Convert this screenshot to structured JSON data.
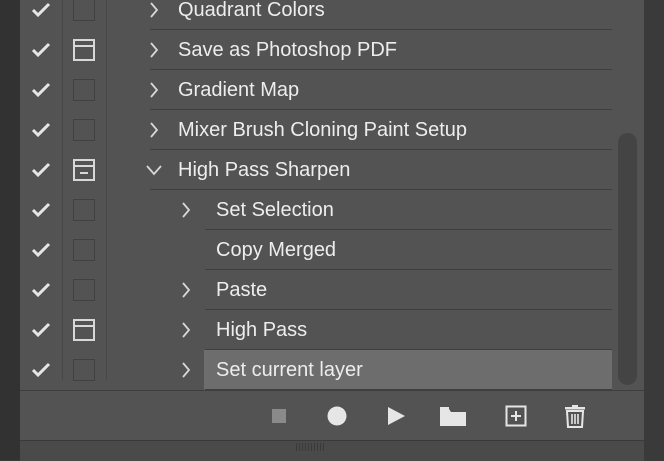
{
  "actions": [
    {
      "label": "Quadrant Colors",
      "enabled": true,
      "dialog": "none",
      "expand": "collapsed",
      "level": 0
    },
    {
      "label": "Save as Photoshop PDF",
      "enabled": true,
      "dialog": "on",
      "expand": "collapsed",
      "level": 0
    },
    {
      "label": "Gradient Map",
      "enabled": true,
      "dialog": "none",
      "expand": "collapsed",
      "level": 0
    },
    {
      "label": "Mixer Brush Cloning Paint Setup",
      "enabled": true,
      "dialog": "none",
      "expand": "collapsed",
      "level": 0
    },
    {
      "label": "High Pass Sharpen",
      "enabled": true,
      "dialog": "partial",
      "expand": "expanded",
      "level": 0
    },
    {
      "label": "Set Selection",
      "enabled": true,
      "dialog": "none",
      "expand": "collapsed",
      "level": 1
    },
    {
      "label": "Copy Merged",
      "enabled": true,
      "dialog": "none",
      "expand": "none",
      "level": 1
    },
    {
      "label": "Paste",
      "enabled": true,
      "dialog": "none",
      "expand": "collapsed",
      "level": 1
    },
    {
      "label": "High Pass",
      "enabled": true,
      "dialog": "on",
      "expand": "collapsed",
      "level": 1
    },
    {
      "label": "Set current layer",
      "enabled": true,
      "dialog": "none",
      "expand": "collapsed",
      "level": 1,
      "selected": true
    }
  ],
  "toolbar": {
    "buttons": [
      {
        "name": "stop-icon"
      },
      {
        "name": "record-icon"
      },
      {
        "name": "play-icon"
      },
      {
        "name": "folder-icon"
      },
      {
        "name": "new-action-icon"
      },
      {
        "name": "trash-icon"
      }
    ]
  },
  "colors": {
    "panel": "#535353",
    "selected_row": "#6d6d6d",
    "text": "#ededed",
    "icon": "#d8d8d8"
  }
}
